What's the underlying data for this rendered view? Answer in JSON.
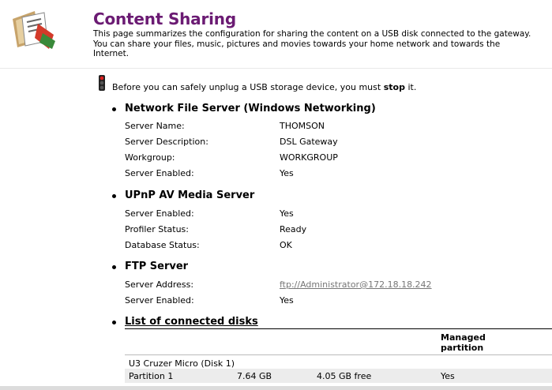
{
  "page": {
    "title": "Content Sharing",
    "intro": "This page summarizes the configuration for sharing the content on a USB disk connected to the gateway. You can share your files, music, pictures and movies towards your home network and towards the Internet.",
    "warning_prefix": "Before you can safely unplug a USB storage device, you must ",
    "warning_bold": "stop",
    "warning_suffix": " it."
  },
  "nfs": {
    "title": "Network File Server (Windows Networking)",
    "rows": [
      {
        "label": "Server Name:",
        "value": "THOMSON"
      },
      {
        "label": "Server Description:",
        "value": "DSL Gateway"
      },
      {
        "label": "Workgroup:",
        "value": "WORKGROUP"
      },
      {
        "label": "Server Enabled:",
        "value": "Yes"
      }
    ]
  },
  "upnp": {
    "title": "UPnP AV Media Server",
    "rows": [
      {
        "label": "Server Enabled:",
        "value": "Yes"
      },
      {
        "label": "Profiler Status:",
        "value": "Ready"
      },
      {
        "label": "Database Status:",
        "value": "OK"
      }
    ]
  },
  "ftp": {
    "title": "FTP Server",
    "rows": [
      {
        "label": "Server Address:",
        "value": "ftp://Administrator@172.18.18.242"
      },
      {
        "label": "Server Enabled:",
        "value": "Yes"
      }
    ]
  },
  "disks": {
    "title": "List of connected disks",
    "managed_header_1": "Managed",
    "managed_header_2": "partition",
    "disk_name": "U3 Cruzer Micro (Disk 1)",
    "partition": {
      "name": "Partition 1",
      "size": "7.64 GB",
      "free": "4.05 GB free",
      "managed": "Yes"
    }
  },
  "icons": {
    "logo": "content-sharing-icon",
    "warning": "traffic-light-icon"
  },
  "colors": {
    "title": "#6b1b73",
    "link": "#777777"
  }
}
